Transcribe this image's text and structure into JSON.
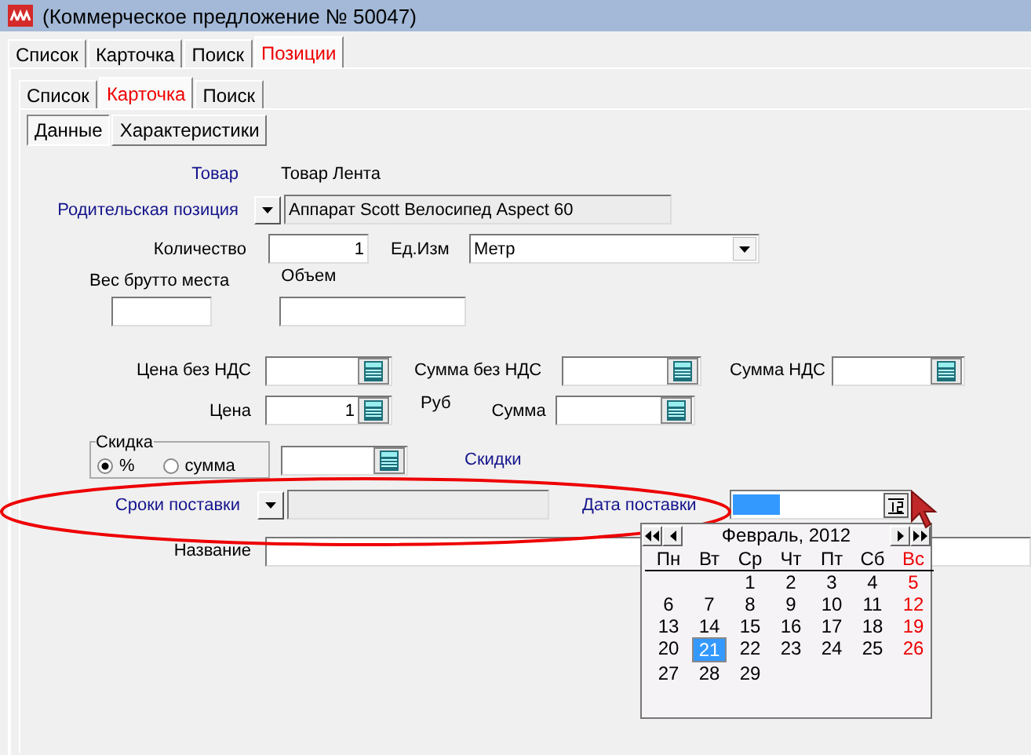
{
  "window": {
    "title": "(Коммерческое предложение № 50047)"
  },
  "tabs": [
    {
      "label": "Список",
      "selected": false
    },
    {
      "label": "Карточка",
      "selected": false
    },
    {
      "label": "Поиск",
      "selected": false
    },
    {
      "label": "Позиции",
      "selected": true
    }
  ],
  "inner_tabs": [
    {
      "label": "Список",
      "selected": false
    },
    {
      "label": "Карточка",
      "selected": true
    },
    {
      "label": "Поиск",
      "selected": false
    }
  ],
  "sub_tabs": [
    {
      "label": "Данные",
      "selected": true
    },
    {
      "label": "Характеристики",
      "selected": false
    }
  ],
  "form": {
    "product": {
      "label": "Товар",
      "link": true,
      "value": "Товар Лента"
    },
    "parent_position": {
      "label": "Родительская позиция",
      "link": true,
      "value": "Аппарат Scott Велосипед Aspect 60",
      "disabled": true
    },
    "quantity": {
      "label": "Количество",
      "link": false,
      "value": "1"
    },
    "unit": {
      "label": "Ед.Изм",
      "link": false,
      "value": "Метр"
    },
    "gross_weight": {
      "label": "Вес брутто места",
      "link": false
    },
    "volume": {
      "label": "Объем",
      "link": false
    },
    "price_no_vat": {
      "label": "Цена без НДС",
      "link": false
    },
    "sum_no_vat": {
      "label": "Сумма без НДС",
      "link": false
    },
    "vat_sum": {
      "label": "Сумма НДС",
      "link": false
    },
    "price": {
      "label": "Цена",
      "link": false,
      "value": "1"
    },
    "currency": "Руб",
    "sum": {
      "label": "Сумма",
      "link": false
    },
    "discount": {
      "label": "Скидка",
      "options": [
        {
          "label": "%",
          "selected": true
        },
        {
          "label": "сумма",
          "selected": false
        }
      ],
      "link_text": "Скидки"
    },
    "delivery_terms": {
      "label": "Сроки поставки",
      "link": true,
      "disabled": true
    },
    "delivery_date": {
      "label": "Дата поставки",
      "link": true
    },
    "name": {
      "label": "Название",
      "link": false
    }
  },
  "calendar": {
    "month": "Февраль, 2012",
    "weekdays": [
      {
        "label": "Пн",
        "weekend": false
      },
      {
        "label": "Вт",
        "weekend": false
      },
      {
        "label": "Ср",
        "weekend": false
      },
      {
        "label": "Чт",
        "weekend": false
      },
      {
        "label": "Пт",
        "weekend": false
      },
      {
        "label": "Сб",
        "weekend": false
      },
      {
        "label": "Вс",
        "weekend": true
      }
    ],
    "weeks": [
      [
        {
          "label": "1",
          "weekend": false,
          "selected": false
        },
        {
          "label": "2",
          "weekend": false,
          "selected": false
        },
        {
          "label": "3",
          "weekend": false,
          "selected": false
        },
        {
          "label": "4",
          "weekend": false,
          "selected": false
        },
        {
          "label": "5",
          "weekend": true,
          "selected": false
        }
      ],
      [
        {
          "label": "6",
          "weekend": false,
          "selected": false
        },
        {
          "label": "7",
          "weekend": false,
          "selected": false
        },
        {
          "label": "8",
          "weekend": false,
          "selected": false
        },
        {
          "label": "9",
          "weekend": false,
          "selected": false
        },
        {
          "label": "10",
          "weekend": false,
          "selected": false
        },
        {
          "label": "11",
          "weekend": false,
          "selected": false
        },
        {
          "label": "12",
          "weekend": true,
          "selected": false
        }
      ],
      [
        {
          "label": "13",
          "weekend": false,
          "selected": false
        },
        {
          "label": "14",
          "weekend": false,
          "selected": false
        },
        {
          "label": "15",
          "weekend": false,
          "selected": false
        },
        {
          "label": "16",
          "weekend": false,
          "selected": false
        },
        {
          "label": "17",
          "weekend": false,
          "selected": false
        },
        {
          "label": "18",
          "weekend": false,
          "selected": false
        },
        {
          "label": "19",
          "weekend": true,
          "selected": false
        }
      ],
      [
        {
          "label": "20",
          "weekend": false,
          "selected": false
        },
        {
          "label": "21",
          "weekend": false,
          "selected": true
        },
        {
          "label": "22",
          "weekend": false,
          "selected": false
        },
        {
          "label": "23",
          "weekend": false,
          "selected": false
        },
        {
          "label": "24",
          "weekend": false,
          "selected": false
        },
        {
          "label": "25",
          "weekend": false,
          "selected": false
        },
        {
          "label": "26",
          "weekend": true,
          "selected": false
        }
      ],
      [
        {
          "label": "27",
          "weekend": false,
          "selected": false
        },
        {
          "label": "28",
          "weekend": false,
          "selected": false
        },
        {
          "label": "29",
          "weekend": false,
          "selected": false
        }
      ]
    ]
  }
}
